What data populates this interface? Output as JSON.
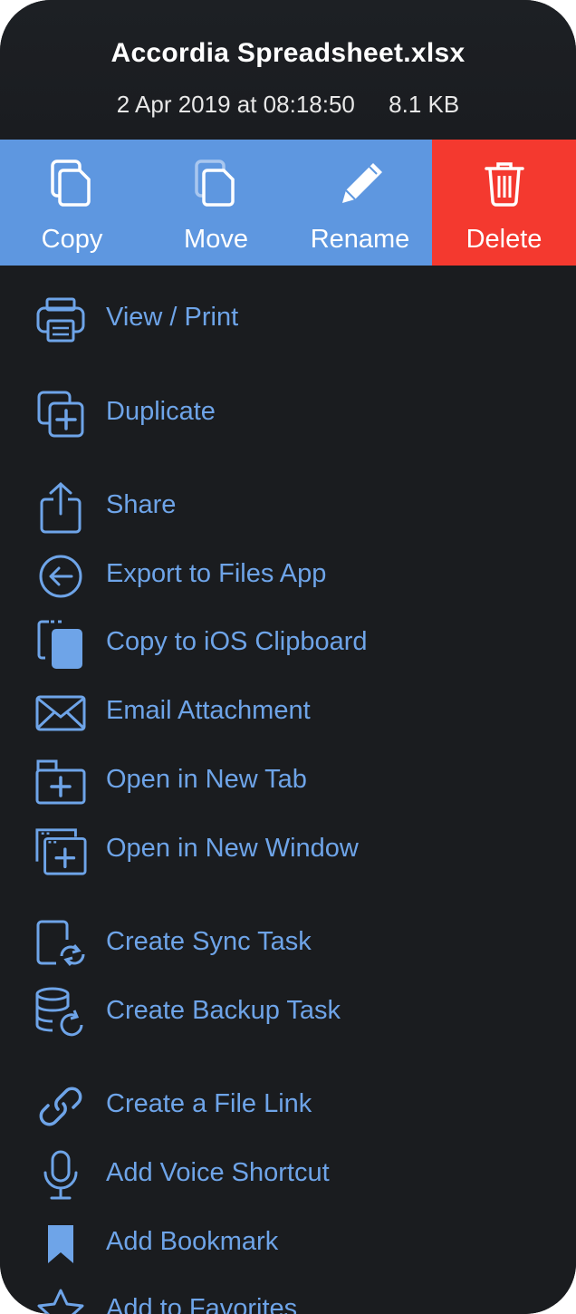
{
  "file": {
    "name": "Accordia Spreadsheet.xlsx",
    "date": "2 Apr 2019 at 08:18:50",
    "size": "8.1 KB"
  },
  "actions": [
    {
      "label": "Copy",
      "icon": "copy-icon"
    },
    {
      "label": "Move",
      "icon": "move-icon"
    },
    {
      "label": "Rename",
      "icon": "pencil-icon"
    },
    {
      "label": "Delete",
      "icon": "trash-icon"
    }
  ],
  "menu": {
    "items": [
      {
        "label": "View / Print",
        "icon": "printer-icon"
      },
      {
        "label": "Duplicate",
        "icon": "duplicate-icon"
      },
      {
        "label": "Share",
        "icon": "share-icon"
      },
      {
        "label": "Export to Files App",
        "icon": "export-arrow-icon"
      },
      {
        "label": "Copy to iOS Clipboard",
        "icon": "clipboard-icon"
      },
      {
        "label": "Email Attachment",
        "icon": "envelope-icon"
      },
      {
        "label": "Open in New Tab",
        "icon": "new-tab-icon"
      },
      {
        "label": "Open in New Window",
        "icon": "new-window-icon"
      },
      {
        "label": "Create Sync Task",
        "icon": "sync-icon"
      },
      {
        "label": "Create Backup Task",
        "icon": "backup-database-icon"
      },
      {
        "label": "Create a File Link",
        "icon": "link-icon"
      },
      {
        "label": "Add Voice Shortcut",
        "icon": "microphone-icon"
      },
      {
        "label": "Add Bookmark",
        "icon": "bookmark-icon"
      },
      {
        "label": "Add to Favorites",
        "icon": "star-icon"
      }
    ]
  },
  "colors": {
    "action_blue": "#5e97e0",
    "delete_red": "#f4392f",
    "menu_text": "#6ea4e8",
    "background": "#17191c"
  }
}
